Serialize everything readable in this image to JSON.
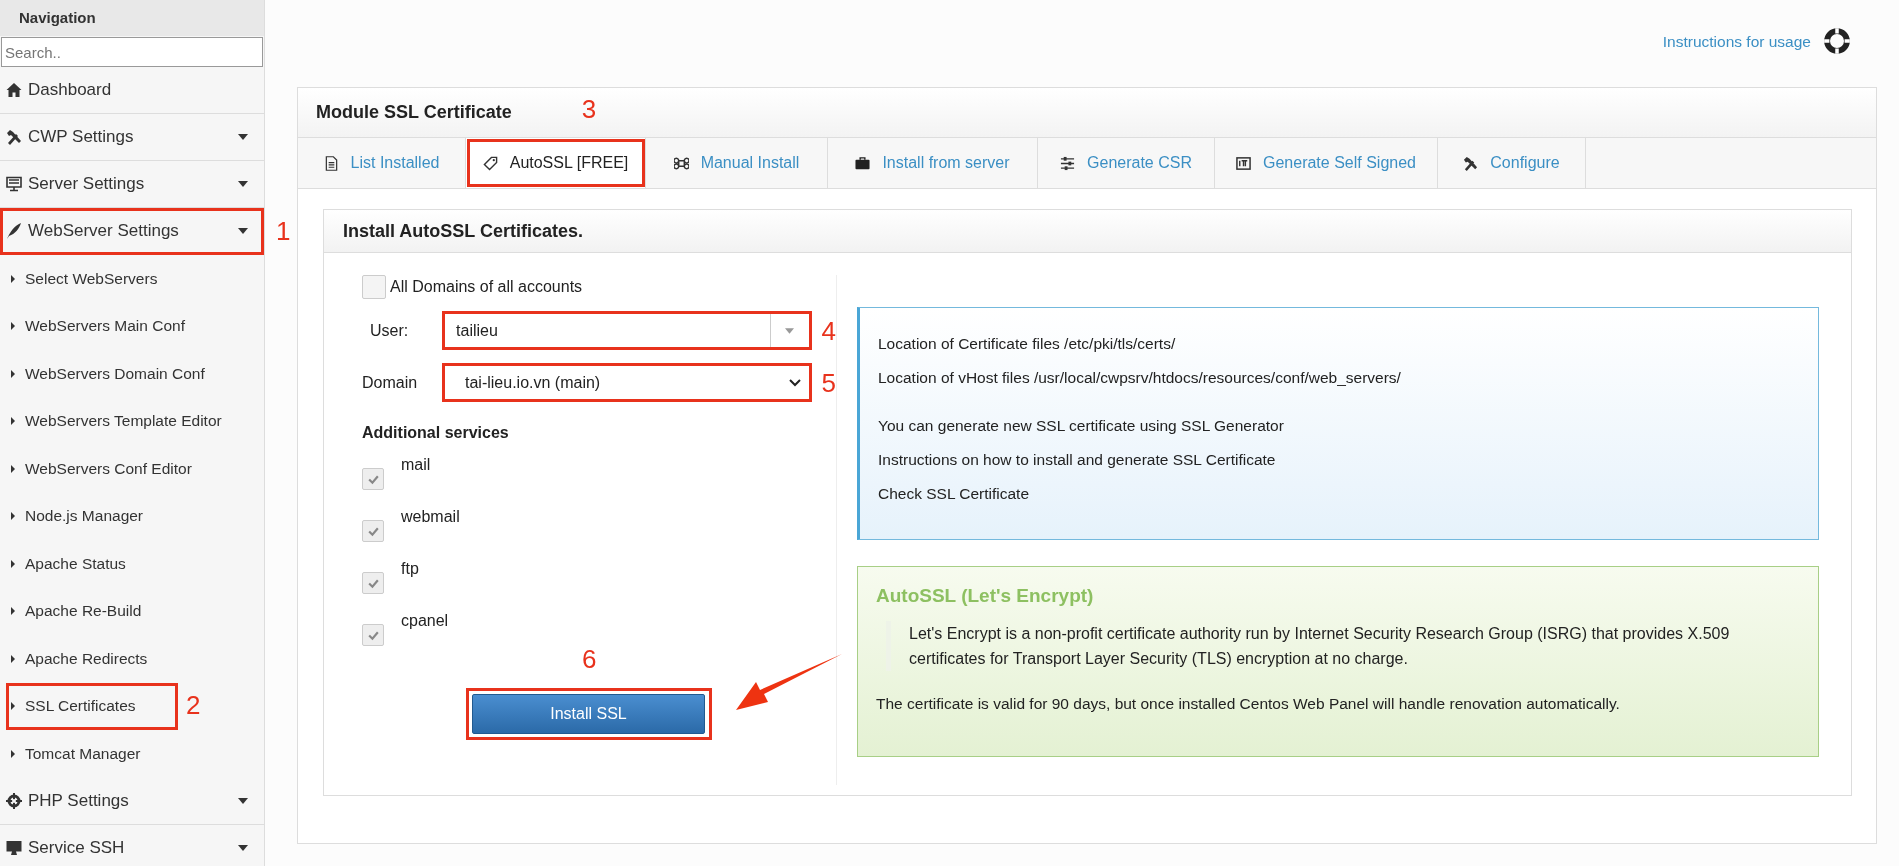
{
  "sidebar": {
    "title": "Navigation",
    "search": {
      "placeholder": "Search.."
    },
    "items": [
      {
        "label": "Dashboard",
        "submenu": false,
        "highlighted": false
      },
      {
        "label": "CWP Settings",
        "submenu": true,
        "expanded": false,
        "highlighted": false
      },
      {
        "label": "Server Settings",
        "submenu": true,
        "expanded": false,
        "highlighted": false
      },
      {
        "label": "WebServer Settings",
        "submenu": true,
        "expanded": true,
        "highlighted": true,
        "callout": "1",
        "children": [
          {
            "label": "Select WebServers",
            "highlighted": false
          },
          {
            "label": "WebServers Main Conf",
            "highlighted": false
          },
          {
            "label": "WebServers Domain Conf",
            "highlighted": false
          },
          {
            "label": "WebServers Template Editor",
            "highlighted": false
          },
          {
            "label": "WebServers Conf Editor",
            "highlighted": false
          },
          {
            "label": "Node.js Manager",
            "highlighted": false
          },
          {
            "label": "Apache Status",
            "highlighted": false
          },
          {
            "label": "Apache Re-Build",
            "highlighted": false
          },
          {
            "label": "Apache Redirects",
            "highlighted": false
          },
          {
            "label": "SSL Certificates",
            "highlighted": true,
            "callout": "2"
          },
          {
            "label": "Tomcat Manager",
            "highlighted": false
          }
        ]
      },
      {
        "label": "PHP Settings",
        "submenu": true,
        "expanded": false,
        "highlighted": false
      },
      {
        "label": "Service SSH",
        "submenu": true,
        "expanded": false,
        "highlighted": false
      }
    ]
  },
  "help_link": "Instructions for usage",
  "module": {
    "title": "Module SSL Certificate",
    "tabs": [
      {
        "label": "List Installed",
        "selected": false,
        "highlighted": false
      },
      {
        "label": "AutoSSL [FREE]",
        "selected": true,
        "highlighted": true,
        "callout": "3"
      },
      {
        "label": "Manual Install",
        "selected": false,
        "highlighted": false
      },
      {
        "label": "Install from server",
        "selected": false,
        "highlighted": false
      },
      {
        "label": "Generate CSR",
        "selected": false,
        "highlighted": false
      },
      {
        "label": "Generate Self Signed",
        "selected": false,
        "highlighted": false
      },
      {
        "label": "Configure",
        "selected": false,
        "highlighted": false
      }
    ],
    "panel": {
      "title": "Install AutoSSL Certificates.",
      "all_domains": {
        "label": "All Domains of all accounts",
        "checked": false
      },
      "user": {
        "label": "User:",
        "value": "tailieu",
        "highlighted": true,
        "callout": "4"
      },
      "domain": {
        "label": "Domain",
        "value": "tai-lieu.io.vn (main)",
        "highlighted": true,
        "callout": "5"
      },
      "services": {
        "title": "Additional services",
        "items": [
          {
            "label": "mail",
            "checked": true
          },
          {
            "label": "webmail",
            "checked": true
          },
          {
            "label": "ftp",
            "checked": true
          },
          {
            "label": "cpanel",
            "checked": true
          }
        ]
      },
      "install_button": {
        "label": "Install SSL",
        "highlighted": true,
        "callout": "6",
        "pointer_arrow": true
      },
      "info": {
        "groups": [
          [
            "Location of Certificate files /etc/pki/tls/certs/",
            "Location of vHost files /usr/local/cwpsrv/htdocs/resources/conf/web_servers/"
          ],
          [
            "You can generate new SSL certificate using SSL Generator",
            "Instructions on how to install and generate SSL Certificate",
            "Check SSL Certificate"
          ]
        ]
      },
      "letsencrypt": {
        "title": "AutoSSL (Let's Encrypt)",
        "quote": "Let's Encrypt is a non-profit certificate authority run by Internet Security Research Group (ISRG) that provides X.509 certificates for Transport Layer Security (TLS) encryption at no charge.",
        "note": "The certificate is valid for 90 days, but once installed Centos Web Panel will handle renovation automatically."
      }
    }
  }
}
